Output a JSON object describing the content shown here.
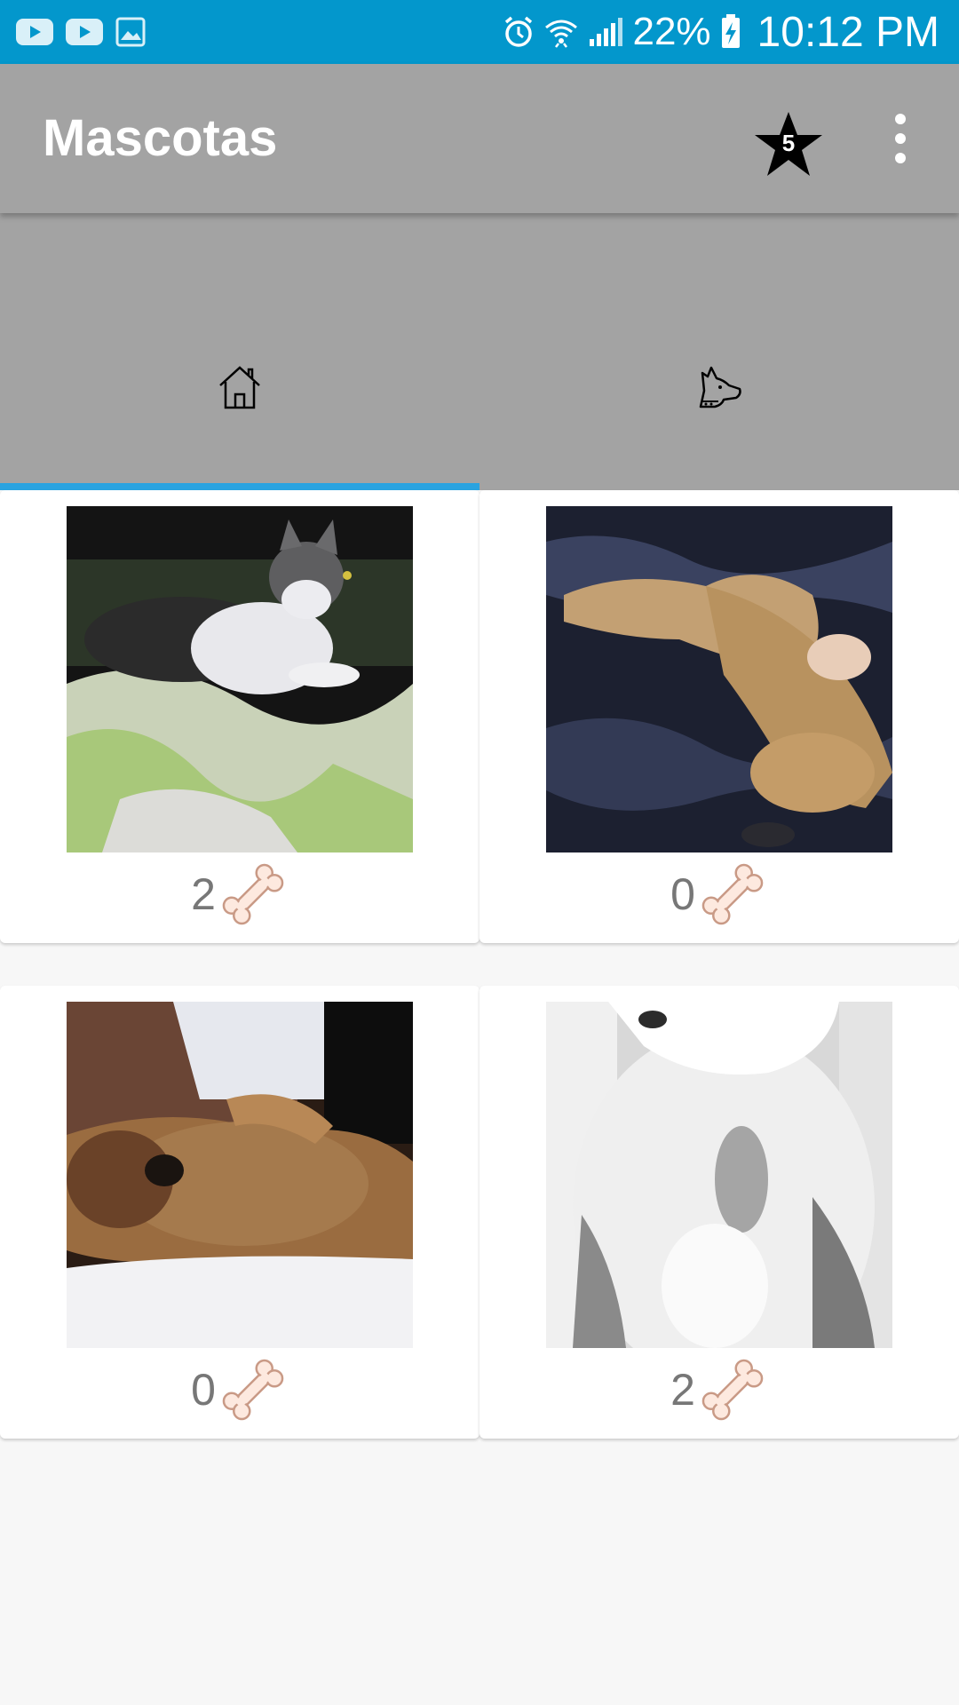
{
  "status_bar": {
    "battery": "22%",
    "time": "10:12 PM"
  },
  "app_bar": {
    "title": "Mascotas",
    "favorites_count": "5"
  },
  "tabs": [
    {
      "icon": "home-icon",
      "selected": true
    },
    {
      "icon": "dog-head-icon",
      "selected": false
    }
  ],
  "pets": [
    {
      "photo": "gray-white-cat-on-bedsheet",
      "likes": "2"
    },
    {
      "photo": "sleeping-tan-dog-on-blanket",
      "likes": "0"
    },
    {
      "photo": "dog-lying-on-back",
      "likes": "0"
    },
    {
      "photo": "white-gray-cat-closeup",
      "likes": "2"
    }
  ],
  "colors": {
    "status_bar": "#0397cc",
    "app_bar": "#a3a3a3",
    "tab_indicator": "#2aa3e0",
    "background": "#f7f7f7"
  }
}
